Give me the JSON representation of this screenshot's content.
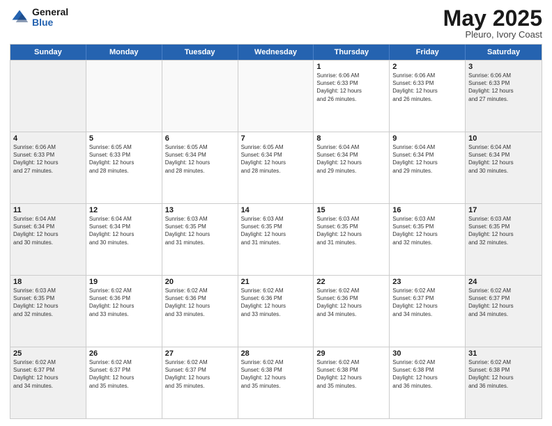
{
  "logo": {
    "general": "General",
    "blue": "Blue"
  },
  "title": {
    "month": "May 2025",
    "location": "Pleuro, Ivory Coast"
  },
  "weekdays": [
    "Sunday",
    "Monday",
    "Tuesday",
    "Wednesday",
    "Thursday",
    "Friday",
    "Saturday"
  ],
  "weeks": [
    [
      {
        "day": "",
        "info": ""
      },
      {
        "day": "",
        "info": ""
      },
      {
        "day": "",
        "info": ""
      },
      {
        "day": "",
        "info": ""
      },
      {
        "day": "1",
        "info": "Sunrise: 6:06 AM\nSunset: 6:33 PM\nDaylight: 12 hours\nand 26 minutes."
      },
      {
        "day": "2",
        "info": "Sunrise: 6:06 AM\nSunset: 6:33 PM\nDaylight: 12 hours\nand 26 minutes."
      },
      {
        "day": "3",
        "info": "Sunrise: 6:06 AM\nSunset: 6:33 PM\nDaylight: 12 hours\nand 27 minutes."
      }
    ],
    [
      {
        "day": "4",
        "info": "Sunrise: 6:06 AM\nSunset: 6:33 PM\nDaylight: 12 hours\nand 27 minutes."
      },
      {
        "day": "5",
        "info": "Sunrise: 6:05 AM\nSunset: 6:33 PM\nDaylight: 12 hours\nand 28 minutes."
      },
      {
        "day": "6",
        "info": "Sunrise: 6:05 AM\nSunset: 6:34 PM\nDaylight: 12 hours\nand 28 minutes."
      },
      {
        "day": "7",
        "info": "Sunrise: 6:05 AM\nSunset: 6:34 PM\nDaylight: 12 hours\nand 28 minutes."
      },
      {
        "day": "8",
        "info": "Sunrise: 6:04 AM\nSunset: 6:34 PM\nDaylight: 12 hours\nand 29 minutes."
      },
      {
        "day": "9",
        "info": "Sunrise: 6:04 AM\nSunset: 6:34 PM\nDaylight: 12 hours\nand 29 minutes."
      },
      {
        "day": "10",
        "info": "Sunrise: 6:04 AM\nSunset: 6:34 PM\nDaylight: 12 hours\nand 30 minutes."
      }
    ],
    [
      {
        "day": "11",
        "info": "Sunrise: 6:04 AM\nSunset: 6:34 PM\nDaylight: 12 hours\nand 30 minutes."
      },
      {
        "day": "12",
        "info": "Sunrise: 6:04 AM\nSunset: 6:34 PM\nDaylight: 12 hours\nand 30 minutes."
      },
      {
        "day": "13",
        "info": "Sunrise: 6:03 AM\nSunset: 6:35 PM\nDaylight: 12 hours\nand 31 minutes."
      },
      {
        "day": "14",
        "info": "Sunrise: 6:03 AM\nSunset: 6:35 PM\nDaylight: 12 hours\nand 31 minutes."
      },
      {
        "day": "15",
        "info": "Sunrise: 6:03 AM\nSunset: 6:35 PM\nDaylight: 12 hours\nand 31 minutes."
      },
      {
        "day": "16",
        "info": "Sunrise: 6:03 AM\nSunset: 6:35 PM\nDaylight: 12 hours\nand 32 minutes."
      },
      {
        "day": "17",
        "info": "Sunrise: 6:03 AM\nSunset: 6:35 PM\nDaylight: 12 hours\nand 32 minutes."
      }
    ],
    [
      {
        "day": "18",
        "info": "Sunrise: 6:03 AM\nSunset: 6:35 PM\nDaylight: 12 hours\nand 32 minutes."
      },
      {
        "day": "19",
        "info": "Sunrise: 6:02 AM\nSunset: 6:36 PM\nDaylight: 12 hours\nand 33 minutes."
      },
      {
        "day": "20",
        "info": "Sunrise: 6:02 AM\nSunset: 6:36 PM\nDaylight: 12 hours\nand 33 minutes."
      },
      {
        "day": "21",
        "info": "Sunrise: 6:02 AM\nSunset: 6:36 PM\nDaylight: 12 hours\nand 33 minutes."
      },
      {
        "day": "22",
        "info": "Sunrise: 6:02 AM\nSunset: 6:36 PM\nDaylight: 12 hours\nand 34 minutes."
      },
      {
        "day": "23",
        "info": "Sunrise: 6:02 AM\nSunset: 6:37 PM\nDaylight: 12 hours\nand 34 minutes."
      },
      {
        "day": "24",
        "info": "Sunrise: 6:02 AM\nSunset: 6:37 PM\nDaylight: 12 hours\nand 34 minutes."
      }
    ],
    [
      {
        "day": "25",
        "info": "Sunrise: 6:02 AM\nSunset: 6:37 PM\nDaylight: 12 hours\nand 34 minutes."
      },
      {
        "day": "26",
        "info": "Sunrise: 6:02 AM\nSunset: 6:37 PM\nDaylight: 12 hours\nand 35 minutes."
      },
      {
        "day": "27",
        "info": "Sunrise: 6:02 AM\nSunset: 6:37 PM\nDaylight: 12 hours\nand 35 minutes."
      },
      {
        "day": "28",
        "info": "Sunrise: 6:02 AM\nSunset: 6:38 PM\nDaylight: 12 hours\nand 35 minutes."
      },
      {
        "day": "29",
        "info": "Sunrise: 6:02 AM\nSunset: 6:38 PM\nDaylight: 12 hours\nand 35 minutes."
      },
      {
        "day": "30",
        "info": "Sunrise: 6:02 AM\nSunset: 6:38 PM\nDaylight: 12 hours\nand 36 minutes."
      },
      {
        "day": "31",
        "info": "Sunrise: 6:02 AM\nSunset: 6:38 PM\nDaylight: 12 hours\nand 36 minutes."
      }
    ]
  ]
}
